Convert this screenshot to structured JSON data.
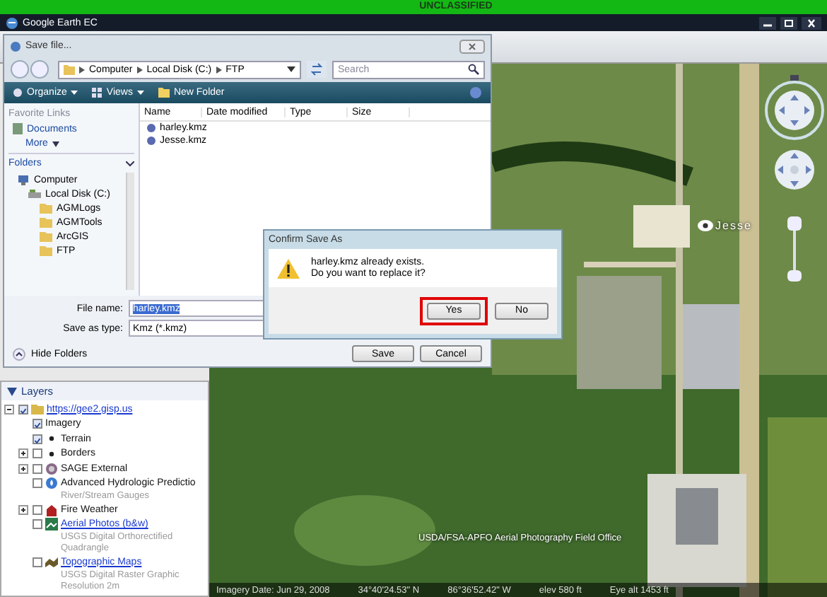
{
  "classification_banner": "UNCLASSIFIED",
  "window": {
    "title": "Google Earth EC"
  },
  "save_dialog": {
    "title": "Save file...",
    "breadcrumb": [
      "Computer",
      "Local Disk (C:)",
      "FTP"
    ],
    "search": {
      "placeholder": "Search"
    },
    "toolbar": [
      "Organize",
      "Views",
      "New Folder"
    ],
    "favorite_links": {
      "heading": "Favorite Links",
      "items": [
        "Documents"
      ],
      "more": "More"
    },
    "folders": {
      "heading": "Folders",
      "tree": [
        {
          "label": "Computer",
          "children": [
            {
              "label": "Local Disk (C:)",
              "children": [
                {
                  "label": "AGMLogs"
                },
                {
                  "label": "AGMTools"
                },
                {
                  "label": "ArcGIS"
                },
                {
                  "label": "FTP"
                }
              ]
            }
          ]
        }
      ]
    },
    "columns": [
      "Name",
      "Date modified",
      "Type",
      "Size"
    ],
    "files": [
      "harley.kmz",
      "Jesse.kmz"
    ],
    "file_name": {
      "label": "File name:",
      "value": "harley.kmz"
    },
    "save_as_type": {
      "label": "Save as type:",
      "value": "Kmz (*.kmz)"
    },
    "hide_folders": "Hide Folders",
    "buttons": [
      "Save",
      "Cancel"
    ]
  },
  "confirm_dialog": {
    "title": "Confirm Save As",
    "message": [
      "harley.kmz already exists.",
      "Do you want to replace it?"
    ],
    "buttons": [
      {
        "label": "Yes",
        "highlighted": true
      },
      {
        "label": "No",
        "highlighted": false
      }
    ]
  },
  "layers": {
    "heading": "Layers",
    "expanded": true,
    "tree": [
      {
        "label": "https://gee2.gisp.us",
        "kind": "server",
        "link": true,
        "checked": true,
        "expanded": true,
        "children": [
          {
            "label": "Imagery",
            "kind": "plain",
            "checked": true
          },
          {
            "label": "Terrain",
            "kind": "point",
            "checked": true
          },
          {
            "label": "Borders",
            "kind": "point",
            "checked": false,
            "expanded": false
          },
          {
            "label": "SAGE External",
            "kind": "service",
            "checked": false,
            "expanded": false
          },
          {
            "label": "Advanced Hydrologic Predictio",
            "kind": "water",
            "checked": false,
            "sub": "River/Stream Gauges"
          },
          {
            "label": "Fire Weather",
            "kind": "alert",
            "checked": false,
            "expanded": false
          },
          {
            "label": "Aerial Photos (b&w)",
            "kind": "image",
            "link": true,
            "checked": false,
            "sub": "USGS Digital Orthorectified Quadrangle"
          },
          {
            "label": "Topographic Maps",
            "kind": "map",
            "link": true,
            "checked": false,
            "sub": "USGS Digital Raster Graphic Resolution 2m"
          }
        ]
      }
    ]
  },
  "map": {
    "placemark": "Jesse",
    "attribution": "USDA/FSA-APFO Aerial Photography Field Office",
    "status_bar": [
      "Imagery Date: Jun 29, 2008",
      "34°40'24.53\" N",
      "86°36'52.42\" W",
      "elev  580 ft",
      "Eye alt  1453 ft"
    ]
  }
}
